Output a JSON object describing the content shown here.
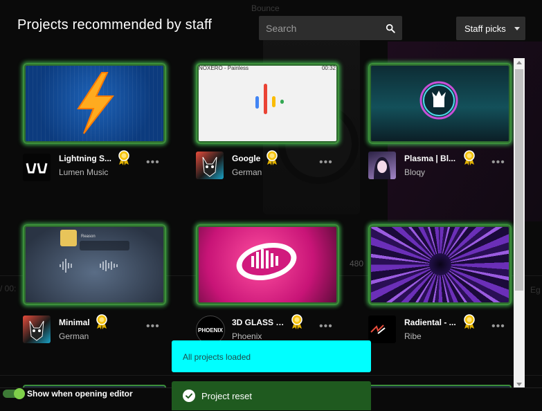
{
  "backdrop": {
    "bounce_label": "Bounce",
    "resolution_hint": "480",
    "time_hint": "/ 00:",
    "edge_hint": "Eg"
  },
  "header": {
    "title": "Projects recommended by staff"
  },
  "search": {
    "placeholder": "Search",
    "icon": "search-icon"
  },
  "filter": {
    "selected": "Staff picks"
  },
  "projects": [
    {
      "name": "Lightning S...",
      "author": "Lumen Music",
      "award": "award-ribbon-icon",
      "thumb_title": "",
      "thumb_time": ""
    },
    {
      "name": "Google",
      "author": "German",
      "award": "award-ribbon-icon",
      "thumb_title": "NOXERO - Painless",
      "thumb_time": "00:32"
    },
    {
      "name": "Plasma | Bl...",
      "author": "Bloqy",
      "award": "award-ribbon-icon",
      "thumb_title": "",
      "thumb_time": ""
    },
    {
      "name": "Minimal",
      "author": "German",
      "award": "award-ribbon-icon",
      "thumb_title": "Reason",
      "thumb_time": ""
    },
    {
      "name": "3D GLASS 2...",
      "author": "Phoenix",
      "award": "award-ribbon-icon",
      "thumb_title": "",
      "thumb_time": ""
    },
    {
      "name": "Radiental - ...",
      "author": "Ribe",
      "award": "award-ribbon-icon",
      "thumb_title": "",
      "thumb_time": ""
    }
  ],
  "avatars": {
    "phoenix_text": "PHOENIX"
  },
  "options_glyph": "•••",
  "footer": {
    "toggle_label": "Show when opening editor",
    "toggle_on": true
  },
  "toasts": {
    "info": "All projects loaded",
    "success": "Project reset"
  },
  "colors": {
    "accent_green": "#3c8f3a",
    "glow": "#5aff6e",
    "info_toast": "#00ffff",
    "success_toast": "#1f5a1f"
  }
}
